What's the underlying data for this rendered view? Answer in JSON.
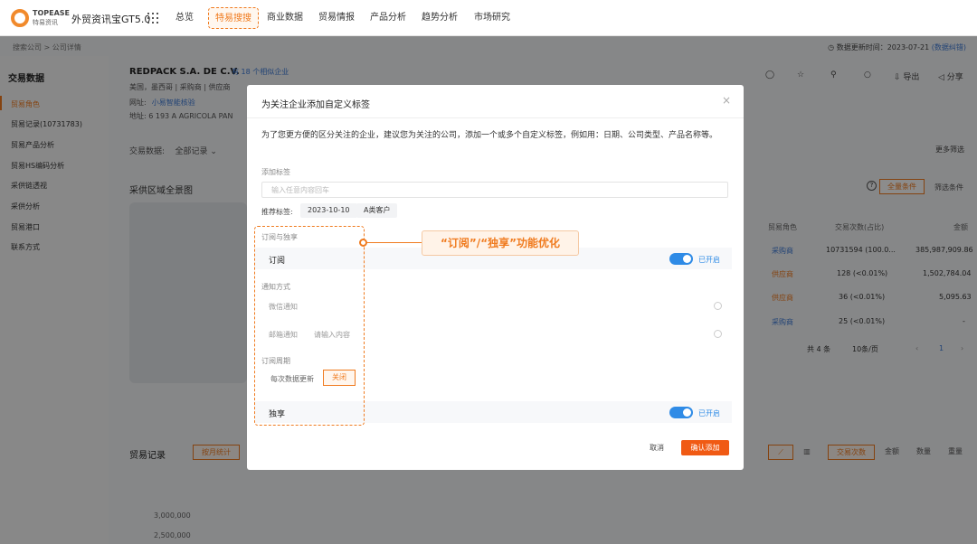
{
  "nav": {
    "logo_text": "TOPEASE",
    "logo_sub": "特易资讯",
    "app_title": "外贸资讯宝GT5.0",
    "items": [
      {
        "label": "总览"
      },
      {
        "label": "特易搜搜"
      },
      {
        "label": "商业数据"
      },
      {
        "label": "贸易情报"
      },
      {
        "label": "产品分析"
      },
      {
        "label": "趋势分析"
      },
      {
        "label": "市场研究"
      }
    ],
    "active_index": 1,
    "accent_color": "#f07b1f"
  },
  "breadcrumb": {
    "root": "搜索公司",
    "sep": ">",
    "current": "公司详情"
  },
  "update": {
    "label": "数据更新时间：2023-07-21",
    "link": "(数据纠错)"
  },
  "sidebar": {
    "title": "交易数据",
    "items": [
      {
        "label": "贸易角色"
      },
      {
        "label": "贸易记录(10731783)"
      },
      {
        "label": "贸易产品分析"
      },
      {
        "label": "贸易HS编码分析"
      },
      {
        "label": "采供链透视"
      },
      {
        "label": "采供分析"
      },
      {
        "label": "贸易港口"
      },
      {
        "label": "联系方式"
      }
    ]
  },
  "company": {
    "name": "REDPACK S.A. DE C.V.",
    "similar": "有 18 个相似企业",
    "tags": "美国，墨西哥 | 采购商 | 供应商",
    "website_label": "网址:",
    "website": "小易智能核验",
    "address": "地址:   6 193 A AGRICOLA PAN"
  },
  "toolbar": {
    "export": "导出",
    "share": "分享"
  },
  "filters": {
    "trade_data": "交易数据:",
    "all_records": "全部记录 ⌄",
    "more": "更多筛选"
  },
  "region": {
    "title": "采供区域全景图",
    "all_cond": "全量条件",
    "filter_cond": "筛选条件"
  },
  "table": {
    "headers": [
      "贸易角色",
      "交易次数(占比)",
      "金额"
    ],
    "rows": [
      {
        "role": "采购商",
        "count": "10731594 (100.0...",
        "amount": "385,987,909.86"
      },
      {
        "role": "供应商",
        "count": "128 (<0.01%)",
        "amount": "1,502,784.04"
      },
      {
        "role": "供应商",
        "count": "36 (<0.01%)",
        "amount": "5,095.63"
      },
      {
        "role": "采购商",
        "count": "25 (<0.01%)",
        "amount": "-"
      }
    ],
    "total": "共 4 条",
    "page_size": "10条/页",
    "page": "1"
  },
  "records": {
    "title": "贸易记录",
    "by_month": "按月统计",
    "yticks": [
      "3,000,000",
      "2,500,000"
    ],
    "trade_count": "交易次数",
    "amount": "金额",
    "quantity": "数量",
    "weight": "重量"
  },
  "modal": {
    "title": "为关注企业添加自定义标签",
    "close": "×",
    "desc": "为了您更方便的区分关注的企业，建议您为关注的公司，添加一个或多个自定义标签，例如用：日期、公司类型、产品名称等。",
    "add_tag_label": "添加标签",
    "tag_placeholder": "输入任意内容回车",
    "rec_label": "推荐标签:",
    "rec_tags": [
      "2023-10-10",
      "A类客户"
    ],
    "sub_section": "订阅与独享",
    "subscribe": "订阅",
    "enabled": "已开启",
    "notify_label": "通知方式",
    "wechat": "微信通知",
    "email": "邮箱通知",
    "email_placeholder": "请输入内容",
    "period_label": "订阅周期",
    "period_opt": "每次数据更新",
    "close_btn": "关闭",
    "exclusive": "独享",
    "cancel": "取消",
    "confirm": "确认添加"
  },
  "callout": {
    "text": "“订阅”/“独享”功能优化"
  }
}
